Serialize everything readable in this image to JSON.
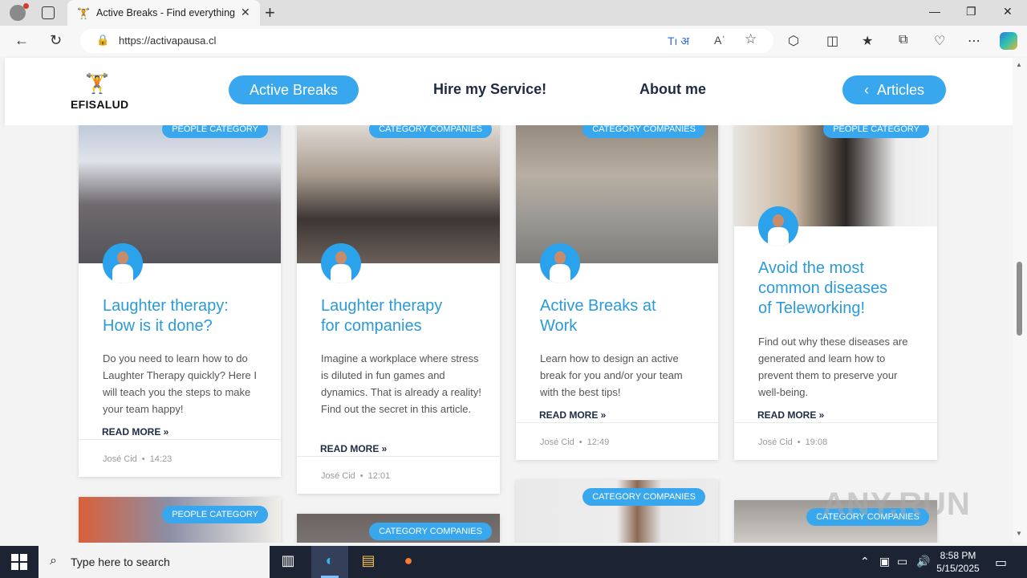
{
  "browser": {
    "tab_title": "Active Breaks - Find everything y",
    "url": "https://activapausa.cl",
    "translate_label": "Tı अ",
    "read_aloud_label": "Aʾ"
  },
  "site": {
    "logo_text": "EFISALUD",
    "nav": {
      "active_breaks": "Active Breaks",
      "hire": "Hire my Service!",
      "about": "About me",
      "articles": "Articles"
    }
  },
  "cards": [
    {
      "badge": "PEOPLE CATEGORY",
      "title_line1": "Laughter therapy:",
      "title_line2": "How is it done?",
      "excerpt": "Do you need to learn how to do Laughter Therapy quickly? Here I will teach you the steps to make your team happy!",
      "read_more": "READ MORE »",
      "author": "José Cid",
      "time": "14:23"
    },
    {
      "badge": "CATEGORY COMPANIES",
      "title_line1": "Laughter therapy",
      "title_line2": "for companies",
      "excerpt": "Imagine a workplace where stress is diluted in fun games and dynamics. That is already a reality! Find out the secret in this article.",
      "read_more": "READ MORE »",
      "author": "José Cid",
      "time": "12:01"
    },
    {
      "badge": "CATEGORY COMPANIES",
      "title_line1": "Active Breaks at",
      "title_line2": "Work",
      "excerpt": "Learn how to design an active break for you and/or your team with the best tips!",
      "read_more": "READ MORE »",
      "author": "José Cid",
      "time": "12:49"
    },
    {
      "badge": "PEOPLE CATEGORY",
      "title_line1": "Avoid the most",
      "title_line2": "common diseases",
      "title_line3": "of Teleworking!",
      "excerpt": "Find out why these diseases are generated and learn how to prevent them to preserve your well-being.",
      "read_more": "READ MORE »",
      "author": "José Cid",
      "time": "19:08"
    }
  ],
  "second_row": [
    {
      "badge": "PEOPLE CATEGORY"
    },
    {
      "badge": "CATEGORY COMPANIES"
    },
    {
      "badge": "CATEGORY COMPANIES"
    },
    {
      "badge": "CATEGORY COMPANIES"
    }
  ],
  "watermark": "ANY.RUN",
  "taskbar": {
    "search_placeholder": "Type here to search",
    "time": "8:58 PM",
    "date": "5/15/2025"
  },
  "colors": {
    "accent": "#38a7ee",
    "title": "#2b9bd8",
    "nav_text": "#1f2a44"
  }
}
